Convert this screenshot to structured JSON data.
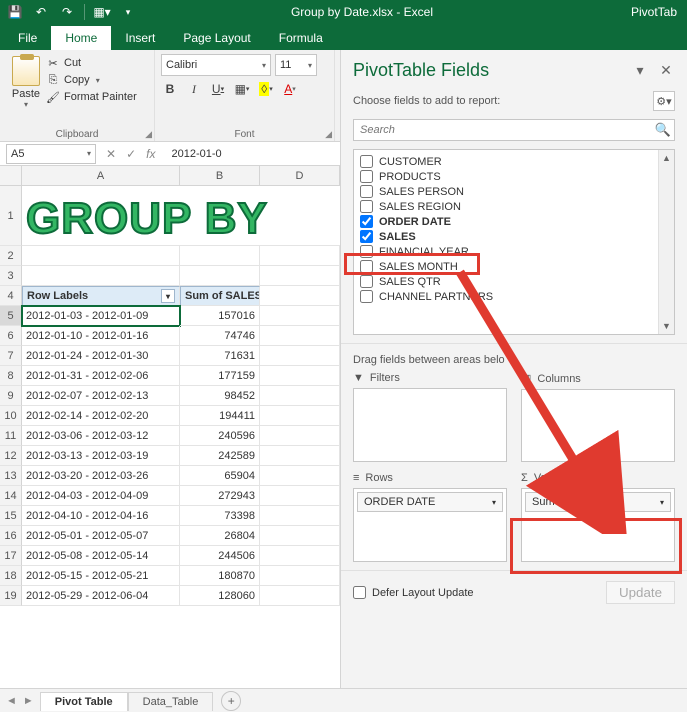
{
  "titlebar": {
    "doc": "Group by Date.xlsx - Excel",
    "right": "PivotTab"
  },
  "tabs": {
    "file": "File",
    "home": "Home",
    "insert": "Insert",
    "pagelayout": "Page Layout",
    "formulas": "Formula"
  },
  "clipboard": {
    "paste": "Paste",
    "cut": "Cut",
    "copy": "Copy",
    "fmt": "Format Painter",
    "label": "Clipboard"
  },
  "font": {
    "name": "Calibri",
    "size": "11",
    "label": "Font"
  },
  "namebox": "A5",
  "formula": "2012-01-0",
  "columns": {
    "A_width": 158,
    "B_width": 80,
    "D_width": 80
  },
  "bigTitle": "GROUP BY",
  "headers": {
    "rowlabels": "Row Labels",
    "sum": "Sum of SALES"
  },
  "rows": [
    {
      "n": 5,
      "a": "2012-01-03 - 2012-01-09",
      "b": "157016"
    },
    {
      "n": 6,
      "a": "2012-01-10 - 2012-01-16",
      "b": "74746"
    },
    {
      "n": 7,
      "a": "2012-01-24 - 2012-01-30",
      "b": "71631"
    },
    {
      "n": 8,
      "a": "2012-01-31 - 2012-02-06",
      "b": "177159"
    },
    {
      "n": 9,
      "a": "2012-02-07 - 2012-02-13",
      "b": "98452"
    },
    {
      "n": 10,
      "a": "2012-02-14 - 2012-02-20",
      "b": "194411"
    },
    {
      "n": 11,
      "a": "2012-03-06 - 2012-03-12",
      "b": "240596"
    },
    {
      "n": 12,
      "a": "2012-03-13 - 2012-03-19",
      "b": "242589"
    },
    {
      "n": 13,
      "a": "2012-03-20 - 2012-03-26",
      "b": "65904"
    },
    {
      "n": 14,
      "a": "2012-04-03 - 2012-04-09",
      "b": "272943"
    },
    {
      "n": 15,
      "a": "2012-04-10 - 2012-04-16",
      "b": "73398"
    },
    {
      "n": 16,
      "a": "2012-05-01 - 2012-05-07",
      "b": "26804"
    },
    {
      "n": 17,
      "a": "2012-05-08 - 2012-05-14",
      "b": "244506"
    },
    {
      "n": 18,
      "a": "2012-05-15 - 2012-05-21",
      "b": "180870"
    },
    {
      "n": 19,
      "a": "2012-05-29 - 2012-06-04",
      "b": "128060"
    }
  ],
  "pane": {
    "title": "PivotTable Fields",
    "choose": "Choose fields to add to report:",
    "search": "Search",
    "fields": [
      {
        "label": "CUSTOMER",
        "checked": false
      },
      {
        "label": "PRODUCTS",
        "checked": false
      },
      {
        "label": "SALES PERSON",
        "checked": false
      },
      {
        "label": "SALES REGION",
        "checked": false
      },
      {
        "label": "ORDER DATE",
        "checked": true
      },
      {
        "label": "SALES",
        "checked": true
      },
      {
        "label": "FINANCIAL YEAR",
        "checked": false
      },
      {
        "label": "SALES MONTH",
        "checked": false
      },
      {
        "label": "SALES QTR",
        "checked": false
      },
      {
        "label": "CHANNEL PARTNERS",
        "checked": false
      }
    ],
    "dragtext": "Drag fields between areas belo",
    "areas": {
      "filters": "Filters",
      "columns": "Columns",
      "rows": "Rows",
      "values": "Values",
      "row_chip": "ORDER DATE",
      "val_chip": "Sum of SALES"
    },
    "defer": "Defer Layout Update",
    "update": "Update"
  },
  "sheets": {
    "active": "Pivot Table",
    "other": "Data_Table"
  }
}
